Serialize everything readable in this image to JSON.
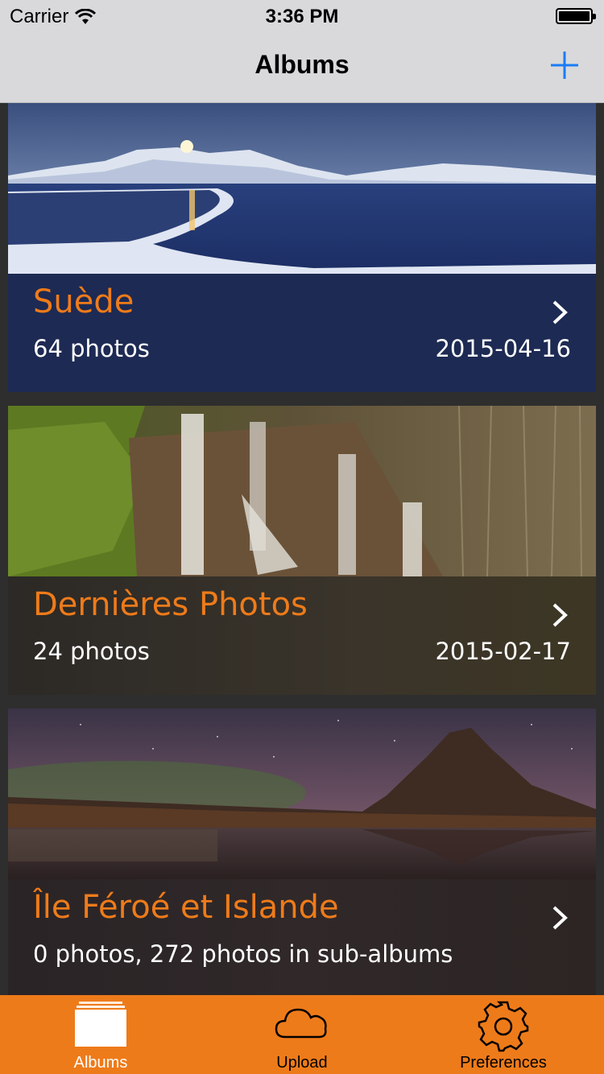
{
  "status_bar": {
    "carrier": "Carrier",
    "time": "3:36 PM"
  },
  "nav": {
    "title": "Albums",
    "add_icon": "plus-icon"
  },
  "albums": [
    {
      "title": "Suède",
      "count": "64 photos",
      "date": "2015-04-16"
    },
    {
      "title": "Dernières Photos",
      "count": "24 photos",
      "date": "2015-02-17"
    },
    {
      "title": "Île Féroé et Islande",
      "count": "0 photos, 272 photos in sub-albums",
      "date": ""
    }
  ],
  "tabs": [
    {
      "label": "Albums",
      "icon": "albums-icon",
      "active": true
    },
    {
      "label": "Upload",
      "icon": "cloud-icon",
      "active": false
    },
    {
      "label": "Preferences",
      "icon": "gear-icon",
      "active": false
    }
  ],
  "colors": {
    "accent": "#ee7b1a",
    "link_blue": "#1a7cf5",
    "nav_bg": "#d9d9db"
  }
}
